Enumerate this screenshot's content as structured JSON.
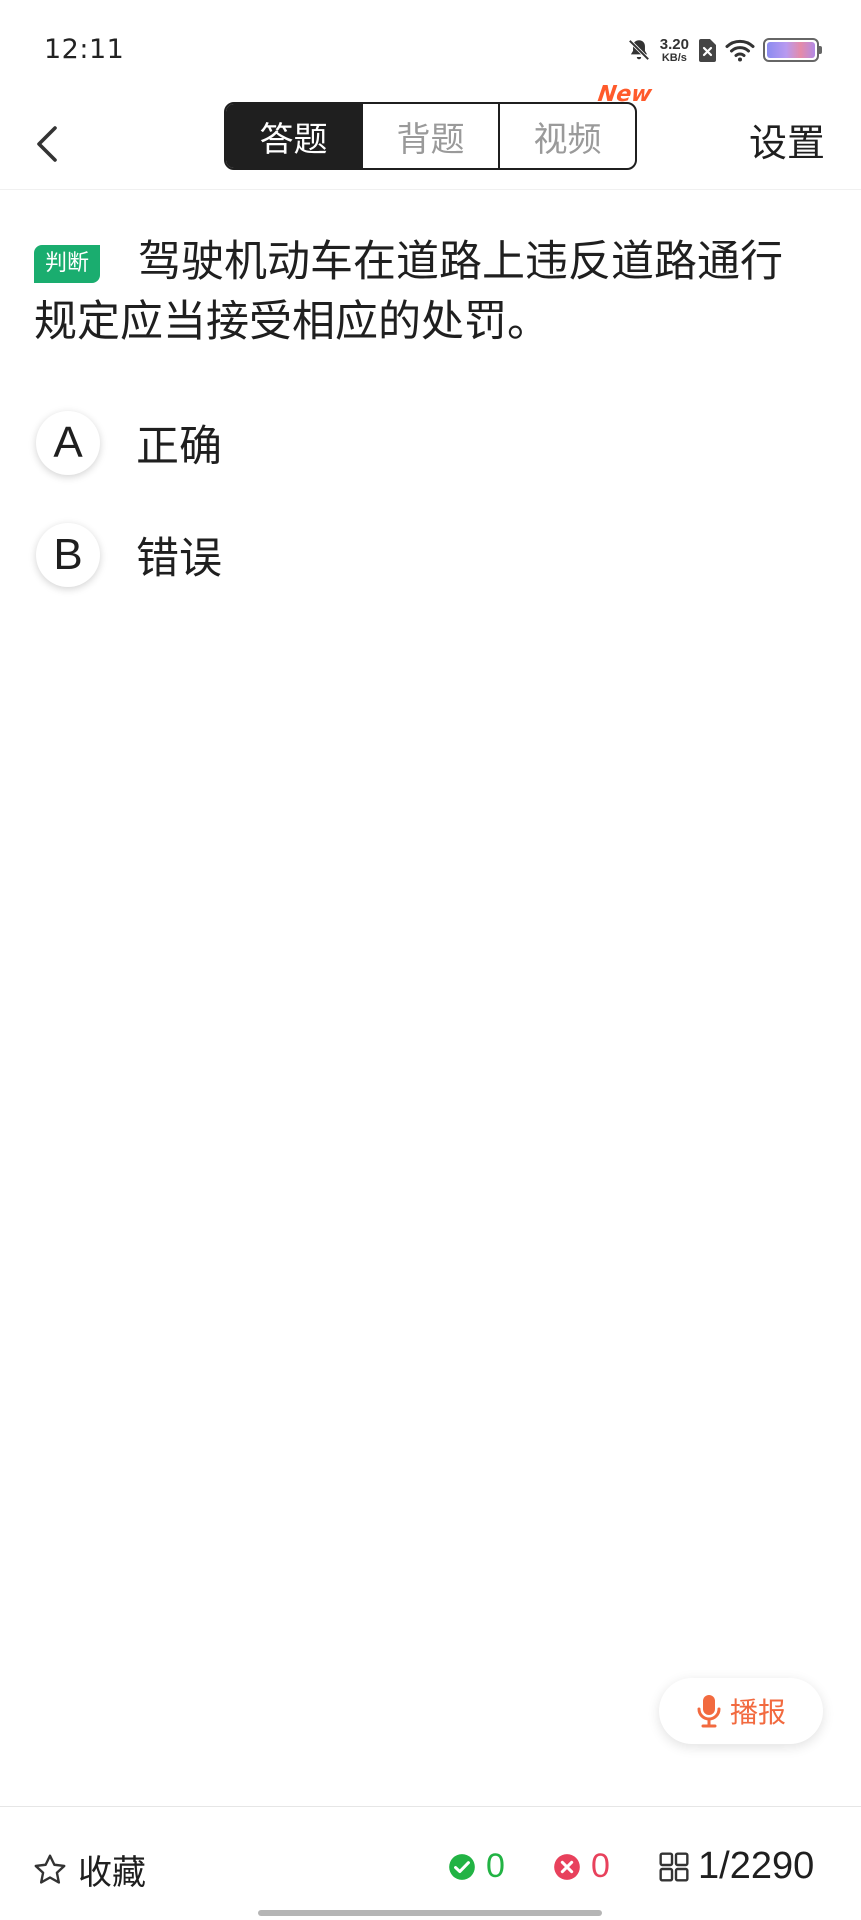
{
  "status_bar": {
    "time": "12:11",
    "net_speed_value": "3.20",
    "net_speed_unit": "KB/s"
  },
  "nav": {
    "tabs": [
      {
        "label": "答题",
        "active": true
      },
      {
        "label": "背题",
        "active": false
      },
      {
        "label": "视频",
        "active": false
      }
    ],
    "new_badge": "New",
    "settings_label": "设置"
  },
  "question": {
    "type_tag": "判断",
    "text": "驾驶机动车在道路上违反道路通行规定应当接受相应的处罚。"
  },
  "options": [
    {
      "letter": "A",
      "text": "正确"
    },
    {
      "letter": "B",
      "text": "错误"
    }
  ],
  "broadcast": {
    "label": "播报"
  },
  "bottom": {
    "favorite_label": "收藏",
    "correct_count": "0",
    "wrong_count": "0",
    "progress": "1/2290"
  },
  "colors": {
    "tag_green": "#1aad6f",
    "new_orange": "#ff5a2b",
    "broadcast_orange": "#f26a3f",
    "correct_green": "#22b344",
    "wrong_red": "#e8415c"
  }
}
